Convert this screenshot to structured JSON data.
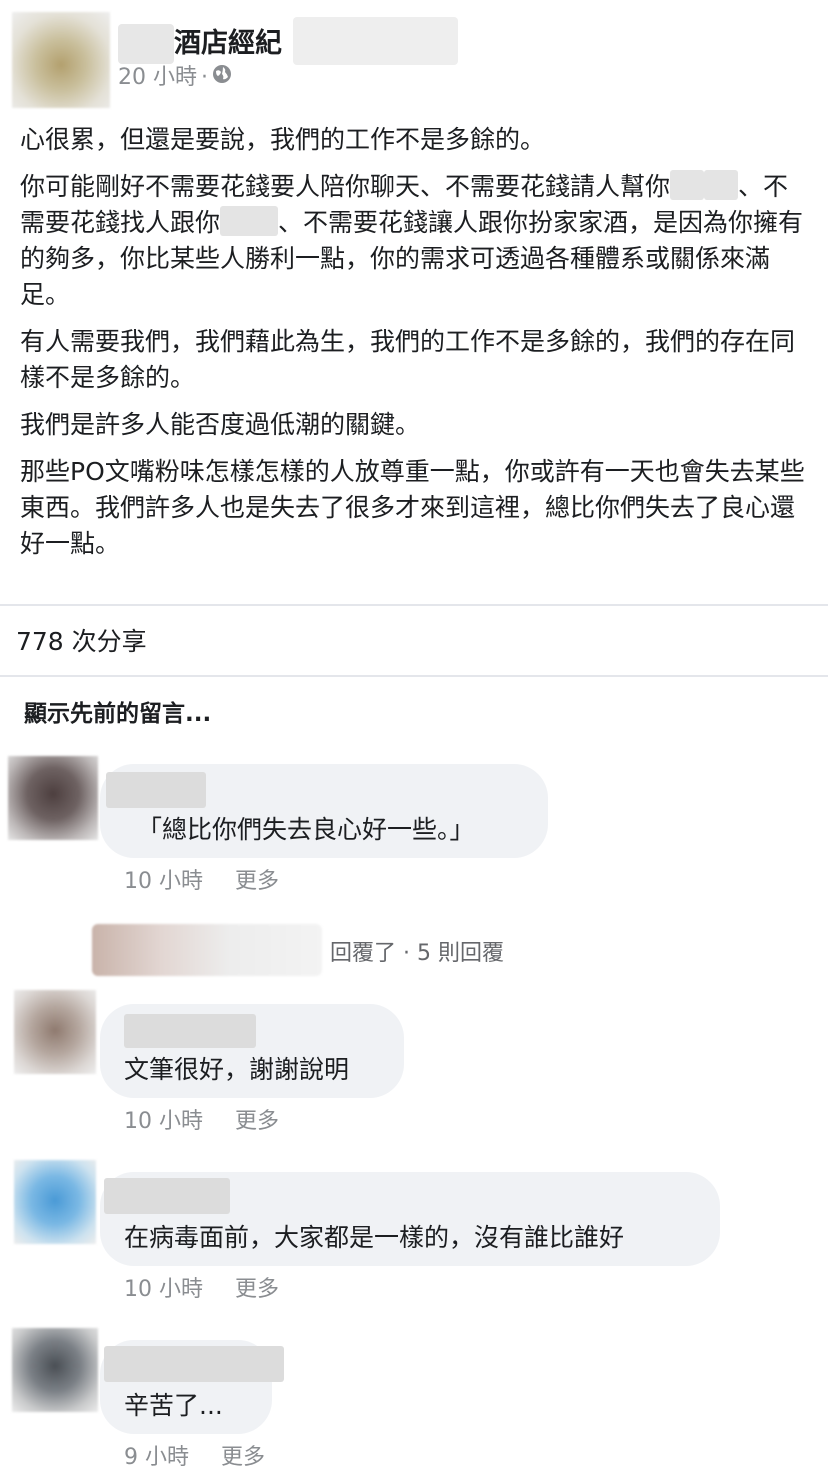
{
  "post": {
    "author_suffix": "酒店經紀",
    "time": "20 小時",
    "separator": "·",
    "privacy_icon": "globe-icon",
    "paragraphs": {
      "p1": "心很累，但還是要說，我們的工作不是多餘的。",
      "p2a": "你可能剛好不需要花錢要人陪你聊天、不需要花錢請人幫你",
      "p2b": "、不需要花錢找人跟你",
      "p2c": "、不需要花錢讓人跟你扮家家酒，是因為你擁有的夠多，你比某些人勝利一點，你的需求可透過各種體系或關係來滿足。",
      "p3": "有人需要我們，我們藉此為生，我們的工作不是多餘的，我們的存在同樣不是多餘的。",
      "p4": "我們是許多人能否度過低潮的關鍵。",
      "p5": "那些PO文嘴粉味怎樣怎樣的人放尊重一點，你或許有一天也會失去某些東西。我們許多人也是失去了很多才來到這裡，總比你們失去了良心還好一點。"
    }
  },
  "shares": {
    "label": "778 次分享"
  },
  "comments_section": {
    "show_previous": "顯示先前的留言...",
    "comments": [
      {
        "text": "「總比你們失去良心好一些。」",
        "time": "10 小時",
        "more": "更多"
      },
      {
        "text": "文筆很好，謝謝說明",
        "time": "10 小時",
        "more": "更多"
      },
      {
        "text": "在病毒面前，大家都是一樣的，沒有誰比誰好",
        "time": "10 小時",
        "more": "更多"
      },
      {
        "text": "辛苦了...",
        "time": "9 小時",
        "more": "更多"
      }
    ],
    "reply_summary": {
      "text": "回覆了 · 5 則回覆"
    }
  },
  "colors": {
    "text": "#1c1e21",
    "meta": "#8a8d91",
    "bubble": "#f0f2f5",
    "divider": "#e4e6eb"
  }
}
